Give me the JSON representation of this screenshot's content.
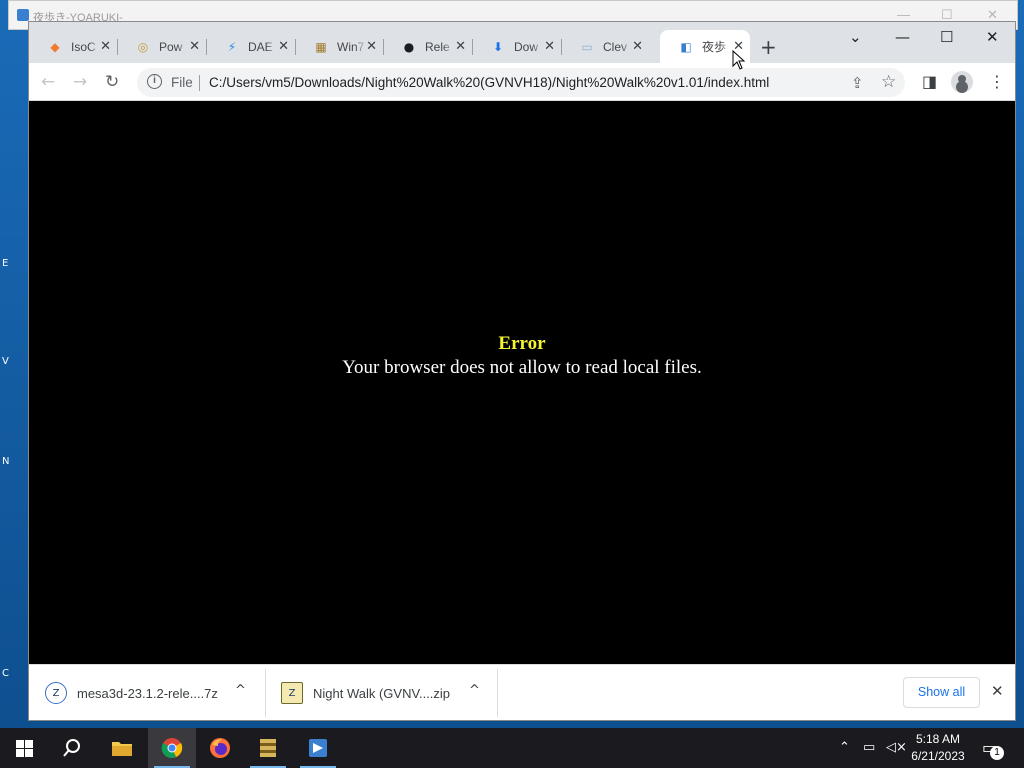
{
  "background_window": {
    "title": "夜歩き-YOARUKI-"
  },
  "tabs": [
    {
      "label": "IsoC",
      "icon": "isocontrol-icon",
      "icon_glyph": "◆",
      "icon_color": "#f07b2e"
    },
    {
      "label": "Pow",
      "icon": "powerbox-icon",
      "icon_glyph": "◎",
      "icon_color": "#c99a3a"
    },
    {
      "label": "DAE",
      "icon": "daemon-bolt-icon",
      "icon_glyph": "⚡",
      "icon_color": "#2a8de8"
    },
    {
      "label": "Win7",
      "icon": "winrar-icon",
      "icon_glyph": "▦",
      "icon_color": "#a07a2a"
    },
    {
      "label": "Rele",
      "icon": "github-icon",
      "icon_glyph": "●",
      "icon_color": "#1b1f23"
    },
    {
      "label": "Dow",
      "icon": "download-icon",
      "icon_glyph": "⬇",
      "icon_color": "#1a73e8"
    },
    {
      "label": "Clev",
      "icon": "clever-icon",
      "icon_glyph": "▭",
      "icon_color": "#8ab4c9"
    },
    {
      "label": "夜歩",
      "icon": "yoaruki-icon",
      "icon_glyph": "◧",
      "icon_color": "#3b7fd0",
      "active": true
    }
  ],
  "tab_close_glyph": "✕",
  "new_tab_glyph": "+",
  "toolbar": {
    "back_glyph": "←",
    "forward_glyph": "→",
    "reload_glyph": "↻",
    "info_glyph": "i",
    "scheme": "File",
    "url": "C:/Users/vm5/Downloads/Night%20Walk%20(GVNVH18)/Night%20Walk%20v1.01/index.html",
    "share_glyph": "⇪",
    "star_glyph": "☆",
    "sidepanel_glyph": "◨",
    "menu_glyph": "⋮"
  },
  "window_controls": {
    "tab_search": "⌄",
    "minimize": "—",
    "maximize": "☐",
    "close": "✕"
  },
  "page": {
    "error_title": "Error",
    "error_message": "Your browser does not allow to read local files."
  },
  "downloads": [
    {
      "name": "mesa3d-23.1.2-rele....7z",
      "icon": "archive-7z-icon",
      "icon_glyph": "Z"
    },
    {
      "name": "Night Walk (GVNV....zip",
      "icon": "archive-zip-icon",
      "icon_glyph": "Z"
    }
  ],
  "caret_glyph": "^",
  "show_all_label": "Show all",
  "shelf_close_glyph": "✕",
  "taskbar": {
    "time": "5:18 AM",
    "date": "6/21/2023",
    "notification_count": "1"
  }
}
